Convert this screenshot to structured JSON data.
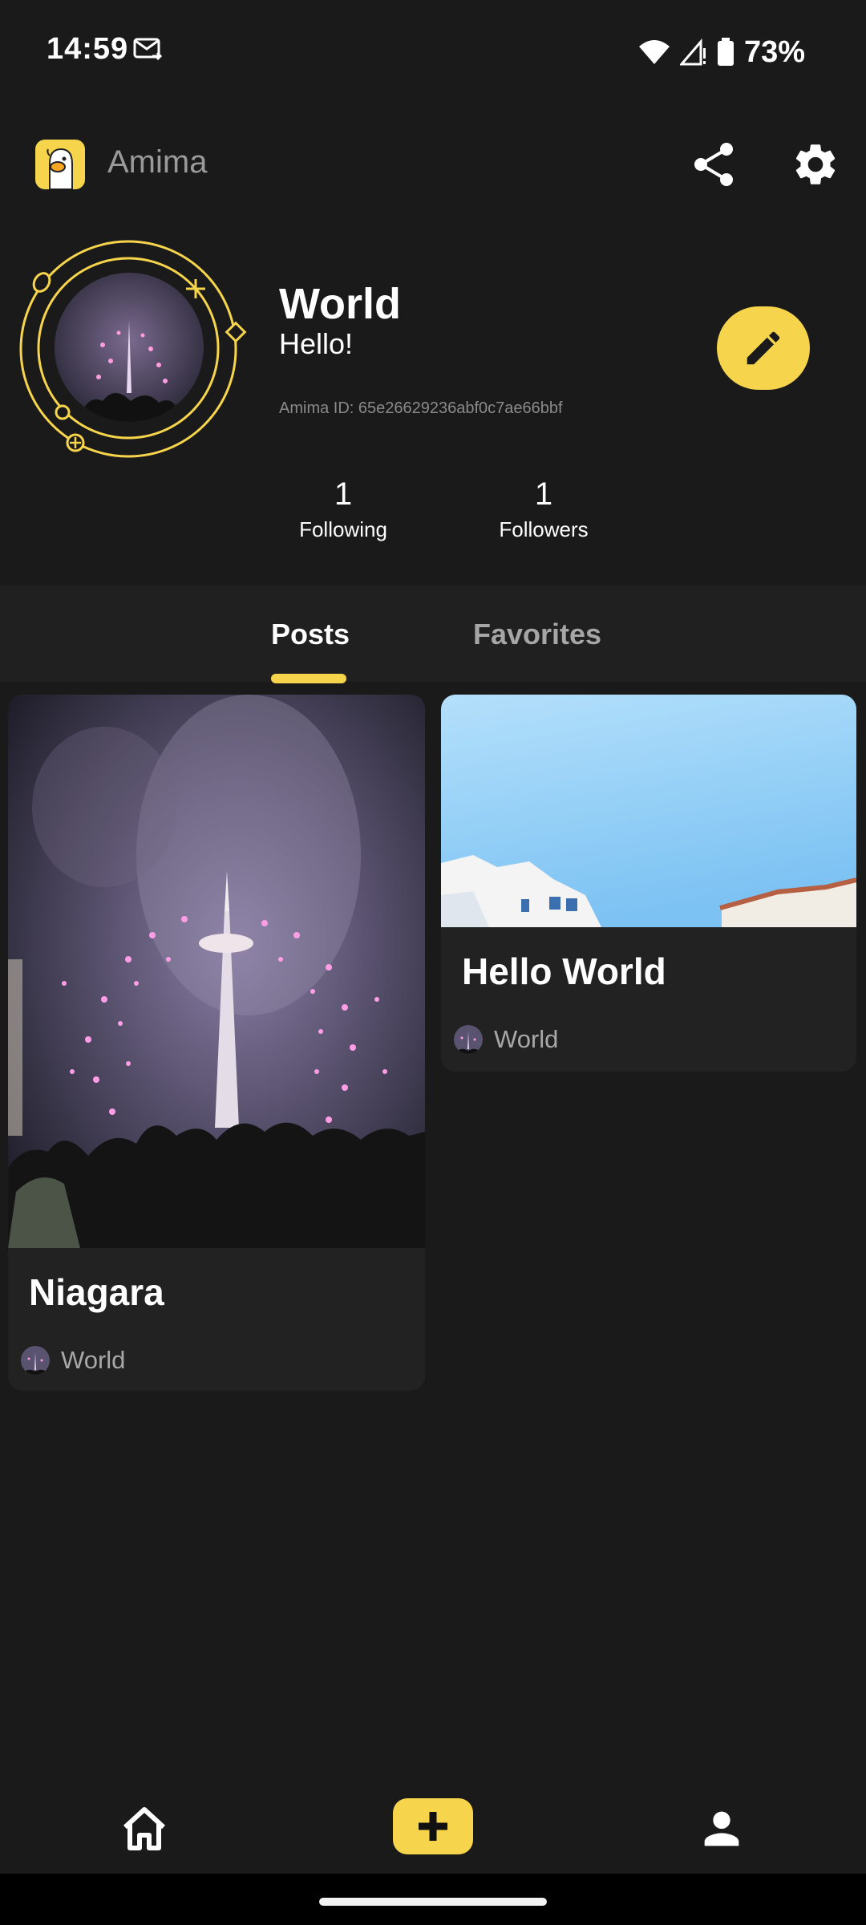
{
  "status_bar": {
    "time": "14:59",
    "battery": "73%"
  },
  "app": {
    "name": "Amima",
    "accent": "#f6d44b"
  },
  "header": {
    "icons": [
      "share-icon",
      "gear-icon"
    ]
  },
  "profile": {
    "name": "World",
    "bio": "Hello!",
    "id_text": "Amima ID: 65e26629236abf0c7ae66bbf"
  },
  "stats": {
    "following_count": "1",
    "following_label": "Following",
    "followers_count": "1",
    "followers_label": "Followers"
  },
  "tabs": [
    {
      "label": "Posts",
      "active": true
    },
    {
      "label": "Favorites",
      "active": false
    }
  ],
  "posts": [
    {
      "title": "Niagara",
      "author": "World",
      "image": "fireworks-tower-photo"
    },
    {
      "title": "Hello World",
      "author": "World",
      "image": "sky-building-photo"
    }
  ],
  "bottom_nav": [
    "home-icon",
    "add-icon",
    "person-icon"
  ]
}
